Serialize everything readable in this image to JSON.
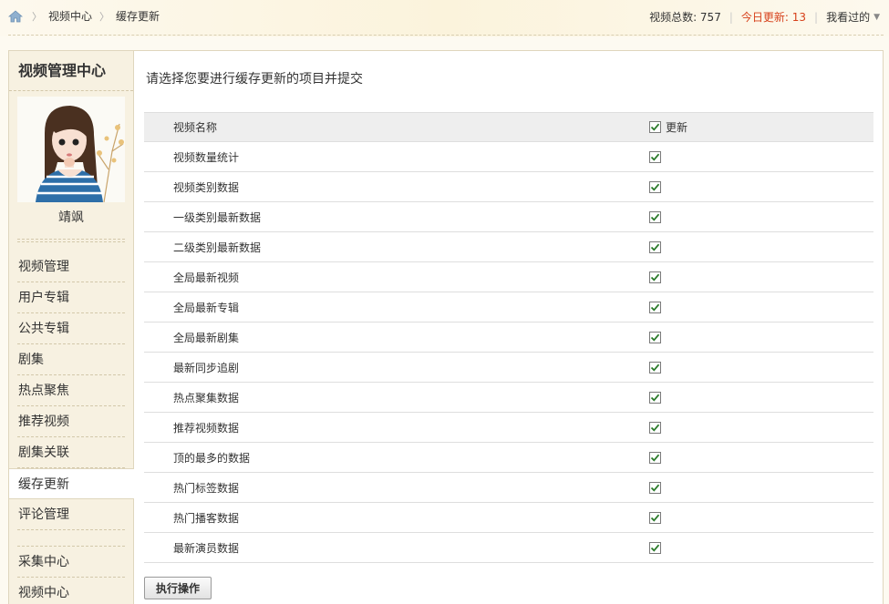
{
  "breadcrumb": {
    "items": [
      "视频中心",
      "缓存更新"
    ]
  },
  "stats": {
    "total": "视频总数: 757",
    "today": "今日更新: 13",
    "history": "我看过的"
  },
  "sidebar": {
    "title": "视频管理中心",
    "username": "靖飒",
    "nav_top": [
      "视频管理",
      "用户专辑",
      "公共专辑",
      "剧集",
      "热点聚焦",
      "推荐视频",
      "剧集关联",
      "缓存更新",
      "评论管理"
    ],
    "nav_bottom": [
      "采集中心",
      "视频中心"
    ],
    "active": "缓存更新"
  },
  "main": {
    "prompt": "请选择您要进行缓存更新的项目并提交",
    "header": {
      "name": "视频名称",
      "update": "更新"
    },
    "rows": [
      "视频数量统计",
      "视频类别数据",
      "一级类别最新数据",
      "二级类别最新数据",
      "全局最新视频",
      "全局最新专辑",
      "全局最新剧集",
      "最新同步追剧",
      "热点聚集数据",
      "推荐视频数据",
      "顶的最多的数据",
      "热门标签数据",
      "热门播客数据",
      "最新演员数据"
    ],
    "submit": "执行操作"
  },
  "colors": {
    "accent": "#d6401a",
    "check": "#2a7a2a",
    "sidebar_bg": "#f7f1e1"
  }
}
